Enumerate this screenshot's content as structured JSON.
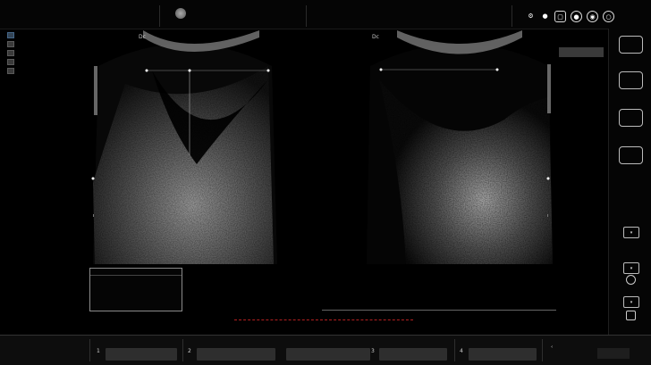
{
  "top": {
    "title": "",
    "center": "",
    "right_left": "",
    "right_right": ""
  },
  "left_panel": {
    "header": "",
    "items": [
      "",
      "",
      "",
      ""
    ]
  },
  "images": {
    "left": {
      "label": "Dc"
    },
    "right": {
      "label": "Dc"
    }
  },
  "params": {
    "rows": [
      {
        "k": "",
        "v": ""
      },
      {
        "k": "",
        "v": ""
      },
      {
        "k": "",
        "v": ""
      },
      {
        "k": "",
        "v": ""
      },
      {
        "k": "",
        "v": ""
      },
      {
        "k": "",
        "v": ""
      },
      {
        "k": "",
        "v": ""
      },
      {
        "k": "",
        "v": ""
      },
      {
        "k": "",
        "v": ""
      }
    ]
  },
  "measurement": {
    "rows": [
      {
        "k": "",
        "v": ""
      },
      {
        "k": "",
        "v": ""
      },
      {
        "k": "",
        "v": ""
      },
      {
        "k": "",
        "v": ""
      }
    ]
  },
  "right_column": {
    "buttons": [
      "",
      "",
      "",
      ""
    ],
    "small_buttons": [
      "",
      "",
      ""
    ]
  },
  "bottom": {
    "left_top": "",
    "left_bottom": "",
    "groups": [
      {
        "num": "1",
        "label": "",
        "value": ""
      },
      {
        "num": "2",
        "label": "",
        "value": ""
      },
      {
        "num": "3",
        "label": "",
        "value": ""
      },
      {
        "num": "4",
        "label": "",
        "value": ""
      }
    ],
    "right_a": "",
    "right_b": ""
  },
  "colors": {
    "background": "#000000",
    "panel": "#0d0d0d",
    "field": "#2e2e2e",
    "status_red": "#b32020",
    "text": "#d8d8d8"
  }
}
